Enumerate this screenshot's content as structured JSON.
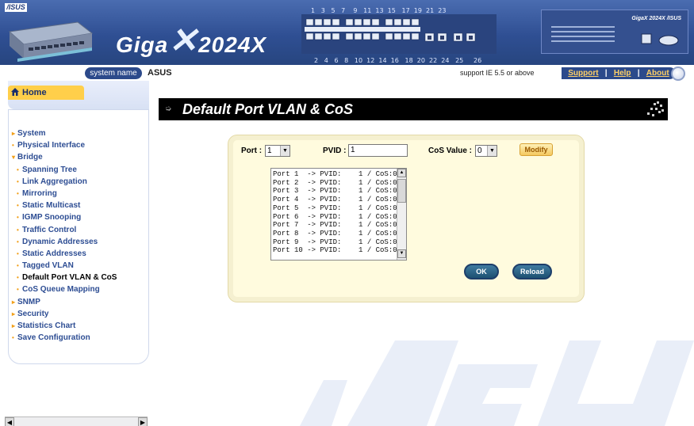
{
  "header": {
    "logo_text": "/ISUS",
    "product_brand": "Giga",
    "product_model": "2024X",
    "panel_port_numbers_top": "1   3   5   7    9   11  13  15   17  19  21  23",
    "panel_port_numbers_bottom": "2   4   6   8   10  12  14  16   18  20  22  24   25     26",
    "right_panel_brand": "GigaX 2024X /ISUS"
  },
  "subbar": {
    "system_name_label": "system name",
    "system_name_value": "ASUS",
    "support_note": "support IE 5.5 or above",
    "links": [
      "Support",
      "Help",
      "About"
    ]
  },
  "sidebar": {
    "home_tab_label": "Home",
    "menu": [
      {
        "label": "System",
        "level": 0,
        "bullet": "▸"
      },
      {
        "label": "Physical Interface",
        "level": 0,
        "bullet": "•"
      },
      {
        "label": "Bridge",
        "level": 0,
        "bullet": "▾"
      },
      {
        "label": "Spanning Tree",
        "level": 1,
        "bullet": "•"
      },
      {
        "label": "Link Aggregation",
        "level": 1,
        "bullet": "•"
      },
      {
        "label": "Mirroring",
        "level": 1,
        "bullet": "•"
      },
      {
        "label": "Static Multicast",
        "level": 1,
        "bullet": "•"
      },
      {
        "label": "IGMP Snooping",
        "level": 1,
        "bullet": "•"
      },
      {
        "label": "Traffic Control",
        "level": 1,
        "bullet": "•"
      },
      {
        "label": "Dynamic Addresses",
        "level": 1,
        "bullet": "•"
      },
      {
        "label": "Static Addresses",
        "level": 1,
        "bullet": "•"
      },
      {
        "label": "Tagged VLAN",
        "level": 1,
        "bullet": "•"
      },
      {
        "label": "Default Port VLAN & CoS",
        "level": 1,
        "bullet": "•",
        "active": true
      },
      {
        "label": "CoS Queue Mapping",
        "level": 1,
        "bullet": "•"
      },
      {
        "label": "SNMP",
        "level": 0,
        "bullet": "▸"
      },
      {
        "label": "Security",
        "level": 0,
        "bullet": "▸"
      },
      {
        "label": "Statistics Chart",
        "level": 0,
        "bullet": "▸"
      },
      {
        "label": "Save Configuration",
        "level": 0,
        "bullet": "•"
      }
    ]
  },
  "main": {
    "title": "Default Port VLAN & CoS",
    "port_label": "Port :",
    "port_value": "1",
    "pvid_label": "PVID :",
    "pvid_value": "1",
    "cos_label": "CoS Value :",
    "cos_value": "0",
    "modify_label": "Modify",
    "ok_label": "OK",
    "reload_label": "Reload",
    "port_list": [
      "Port 1  -> PVID:    1 / CoS:0",
      "Port 2  -> PVID:    1 / CoS:0",
      "Port 3  -> PVID:    1 / CoS:0",
      "Port 4  -> PVID:    1 / CoS:0",
      "Port 5  -> PVID:    1 / CoS:0",
      "Port 6  -> PVID:    1 / CoS:0",
      "Port 7  -> PVID:    1 / CoS:0",
      "Port 8  -> PVID:    1 / CoS:0",
      "Port 9  -> PVID:    1 / CoS:0",
      "Port 10 -> PVID:    1 / CoS:0"
    ]
  },
  "colors": {
    "header_blue": "#2f4f93",
    "menu_text": "#2d4d93",
    "bullet_orange": "#f2a01a",
    "panel_bg": "#fffbde",
    "button_teal": "#1d5172"
  }
}
